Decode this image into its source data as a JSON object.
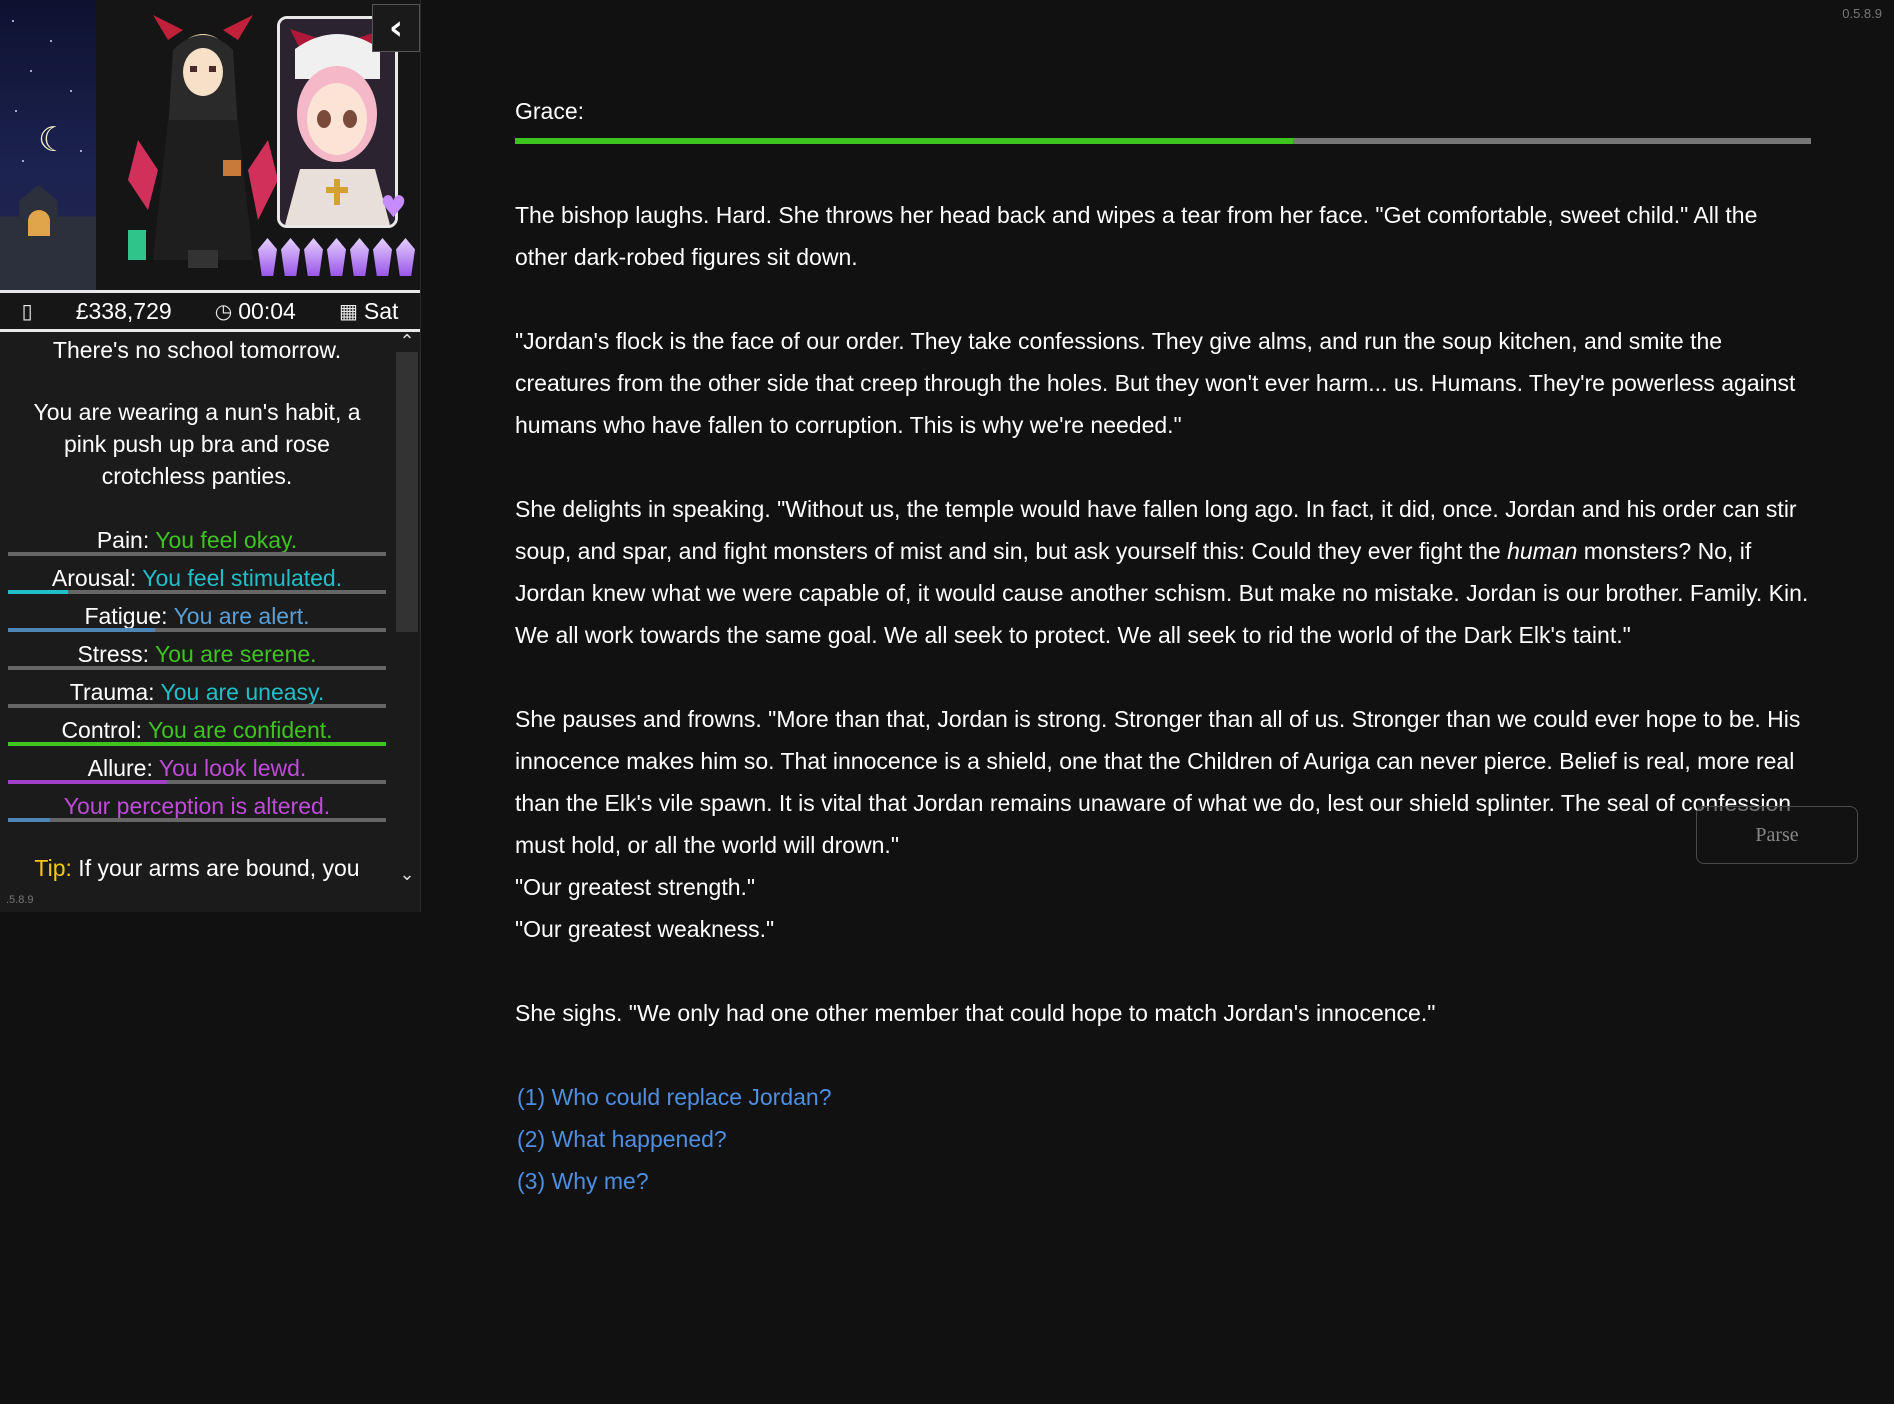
{
  "version": "0.5.8.9",
  "sidebar_version": ".5.8.9",
  "status": {
    "phone_icon": "phone-icon",
    "money": "£338,729",
    "clock_icon": "clock-icon",
    "time": "00:04",
    "calendar_icon": "calendar-icon",
    "day": "Sat"
  },
  "sidebar_text": {
    "school": "There's no school tomorrow.",
    "clothing": "You are wearing a nun's habit, a pink push up bra and rose crotchless panties."
  },
  "stats": [
    {
      "name": "Pain:",
      "desc": "You feel okay.",
      "level": 0.0,
      "color": "#3ec421",
      "bar_color": "#666666"
    },
    {
      "name": "Arousal:",
      "desc": "You feel stimulated.",
      "level": 0.16,
      "color": "#22bfc9",
      "bar_color": "#22bfc9"
    },
    {
      "name": "Fatigue:",
      "desc": "You are alert.",
      "level": 0.39,
      "color": "#5aa0d8",
      "bar_color": "#4f86b8"
    },
    {
      "name": "Stress:",
      "desc": "You are serene.",
      "level": 0.0,
      "color": "#3ec421",
      "bar_color": "#666666"
    },
    {
      "name": "Trauma:",
      "desc": "You are uneasy.",
      "level": 0.0,
      "color": "#22bfc9",
      "bar_color": "#666666"
    },
    {
      "name": "Control:",
      "desc": "You are confident.",
      "level": 1.0,
      "color": "#3ec421",
      "bar_color": "#3ec421"
    },
    {
      "name": "Allure:",
      "desc": "You look lewd.",
      "level": 0.42,
      "color": "#c04ad9",
      "bar_color": "#a040c8"
    },
    {
      "name": "",
      "desc": "Your perception is altered.",
      "level": 0.11,
      "color": "#c04ad9",
      "bar_color": "#4f86b8"
    }
  ],
  "tip": {
    "label": "Tip:",
    "text": " If your arms are bound, you"
  },
  "collapse_icon": "chevron-left-icon",
  "main": {
    "speaker": "Grace:",
    "speaker_level": 0.6,
    "paragraphs": [
      "The bishop laughs. Hard. She throws her head back and wipes a tear from her face. \"Get comfortable, sweet child.\" All the other dark-robed figures sit down.",
      "\"Jordan's flock is the face of our order. They take confessions. They give alms, and run the soup kitchen, and smite the creatures from the other side that creep through the holes. But they won't ever harm... us. Humans. They're powerless against humans who have fallen to corruption. This is why we're needed.\""
    ],
    "p3_before": "She delights in speaking. \"Without us, the temple would have fallen long ago. In fact, it did, once. Jordan and his order can stir soup, and spar, and fight monsters of mist and sin, but ask yourself this: Could they ever fight the ",
    "p3_italic": "human",
    "p3_after": " monsters? No, if Jordan knew what we were capable of, it would cause another schism. But make no mistake. Jordan is our brother. Family. Kin. We all work towards the same goal. We all seek to protect. We all seek to rid the world of the Dark Elk's taint.\"",
    "p4": "She pauses and frowns. \"More than that, Jordan is strong. Stronger than all of us. Stronger than we could ever hope to be. His innocence makes him so. That innocence is a shield, one that the Children of Auriga can never pierce. Belief is real, more real than the Elk's vile spawn. It is vital that Jordan remains unaware of what we do, lest our shield splinter. The seal of confession must hold, or all the world will drown.\"",
    "line1": "\"Our greatest strength.\"",
    "line2": "\"Our greatest weakness.\"",
    "p5": "She sighs. \"We only had one other member that could hope to match Jordan's innocence.\""
  },
  "choices": [
    "(1) Who could replace Jordan?",
    "(2) What happened?",
    "(3) Why me?"
  ],
  "parse_button": "Parse"
}
